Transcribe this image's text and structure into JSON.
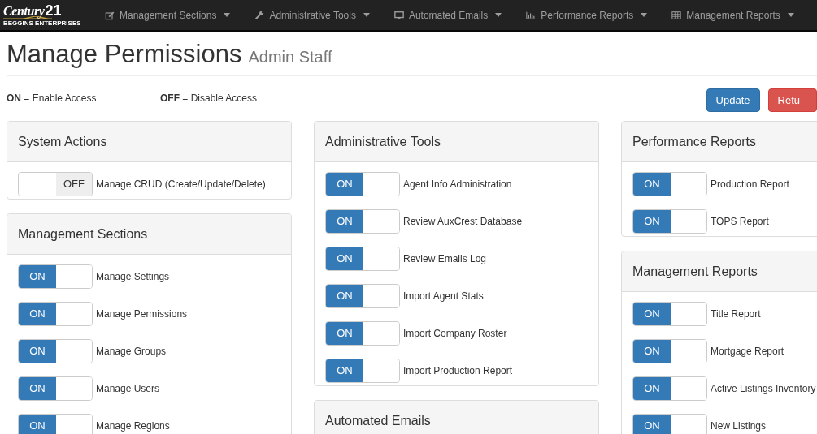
{
  "logo": {
    "wordmark": "Century",
    "number": "21",
    "subtitle": "BEGGINS ENTERPRISES"
  },
  "nav": [
    {
      "kind": "edit",
      "label": "Management Sections"
    },
    {
      "kind": "wrench",
      "label": "Administrative Tools"
    },
    {
      "kind": "monitor",
      "label": "Automated Emails"
    },
    {
      "kind": "chart",
      "label": "Performance Reports"
    },
    {
      "kind": "table",
      "label": "Management Reports"
    }
  ],
  "title": "Manage Permissions",
  "subtitle": "Admin Staff",
  "legend": [
    "**ON** = Enable Access",
    "**OFF** = Disable Access"
  ],
  "buttons": [
    {
      "kind": "primary",
      "label": "Update"
    },
    {
      "kind": "danger",
      "label": "Retu"
    }
  ],
  "columns": [
    [
      {
        "title": "System Actions",
        "items": [
          {
            "label": "Manage CRUD (Create/Update/Delete)",
            "on": false,
            "switch_text": "OFF"
          }
        ]
      },
      {
        "title": "Management Sections",
        "items": [
          {
            "label": "Manage Settings",
            "on": true,
            "switch_text": "ON"
          },
          {
            "label": "Manage Permissions",
            "on": true,
            "switch_text": "ON"
          },
          {
            "label": "Manage Groups",
            "on": true,
            "switch_text": "ON"
          },
          {
            "label": "Manage Users",
            "on": true,
            "switch_text": "ON"
          },
          {
            "label": "Manage Regions",
            "on": true,
            "switch_text": "ON"
          }
        ]
      }
    ],
    [
      {
        "title": "Administrative Tools",
        "items": [
          {
            "label": "Agent Info Administration",
            "on": true,
            "switch_text": "ON"
          },
          {
            "label": "Review AuxCrest Database",
            "on": true,
            "switch_text": "ON"
          },
          {
            "label": "Review Emails Log",
            "on": true,
            "switch_text": "ON"
          },
          {
            "label": "Import Agent Stats",
            "on": true,
            "switch_text": "ON"
          },
          {
            "label": "Import Company Roster",
            "on": true,
            "switch_text": "ON"
          },
          {
            "label": "Import Production Report",
            "on": true,
            "switch_text": "ON"
          }
        ]
      },
      {
        "title": "Automated Emails"
      }
    ],
    [
      {
        "title": "Performance Reports",
        "items": [
          {
            "label": "Production Report",
            "on": true,
            "switch_text": "ON"
          },
          {
            "label": "TOPS Report",
            "on": true,
            "switch_text": "ON"
          }
        ]
      },
      {
        "title": "Management Reports",
        "items": [
          {
            "label": "Title Report",
            "on": true,
            "switch_text": "ON"
          },
          {
            "label": "Mortgage Report",
            "on": true,
            "switch_text": "ON"
          },
          {
            "label": "Active Listings Inventory",
            "on": true,
            "switch_text": "ON"
          },
          {
            "label": "New Listings",
            "on": true,
            "switch_text": "ON"
          }
        ]
      }
    ]
  ]
}
